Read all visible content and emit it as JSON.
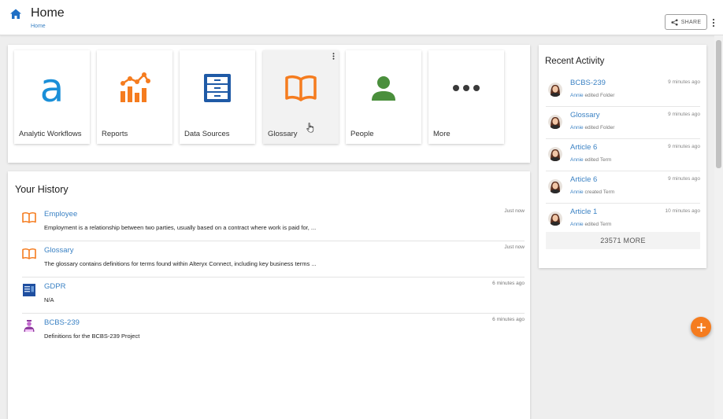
{
  "header": {
    "title": "Home",
    "breadcrumb": "Home",
    "share_label": "SHARE"
  },
  "tiles": [
    {
      "label": "Analytic Workflows",
      "icon": "alteryx-a-icon",
      "color": "#1a8fd8"
    },
    {
      "label": "Reports",
      "icon": "chart-icon",
      "color": "#f57c1f"
    },
    {
      "label": "Data Sources",
      "icon": "cabinet-icon",
      "color": "#1f5aa6"
    },
    {
      "label": "Glossary",
      "icon": "book-icon",
      "color": "#f57c1f"
    },
    {
      "label": "People",
      "icon": "person-icon",
      "color": "#4a8f3c"
    },
    {
      "label": "More",
      "icon": "more-dots-icon",
      "color": "#3a3a3a"
    }
  ],
  "history": {
    "title": "Your History",
    "items": [
      {
        "name": "Employee",
        "description": "Employment is a relationship between two parties, usually based on a contract where work is paid for, ...",
        "time": "Just now",
        "icon": "book-icon"
      },
      {
        "name": "Glossary",
        "description": "The glossary contains definitions for terms found within Alteryx Connect, including key business terms ...",
        "time": "Just now",
        "icon": "book-icon"
      },
      {
        "name": "GDPR",
        "description": "N/A",
        "time": "6 minutes ago",
        "icon": "document-icon"
      },
      {
        "name": "BCBS-239",
        "description": "Definitions for the BCBS-239 Project",
        "time": "6 minutes ago",
        "icon": "project-icon"
      }
    ]
  },
  "activity": {
    "title": "Recent Activity",
    "items": [
      {
        "name": "BCBS-239",
        "user": "Annie",
        "action": "edited Folder",
        "time": "9 minutes ago"
      },
      {
        "name": "Glossary",
        "user": "Annie",
        "action": "edited Folder",
        "time": "9 minutes ago"
      },
      {
        "name": "Article 6",
        "user": "Annie",
        "action": "edited Term",
        "time": "9 minutes ago"
      },
      {
        "name": "Article 6",
        "user": "Annie",
        "action": "created Term",
        "time": "9 minutes ago"
      },
      {
        "name": "Article 1",
        "user": "Annie",
        "action": "edited Term",
        "time": "10 minutes ago"
      }
    ],
    "more_label": "23571 MORE"
  },
  "colors": {
    "accent": "#3b82c4",
    "orange": "#f57c1f",
    "home_icon": "#1f6fc5"
  }
}
